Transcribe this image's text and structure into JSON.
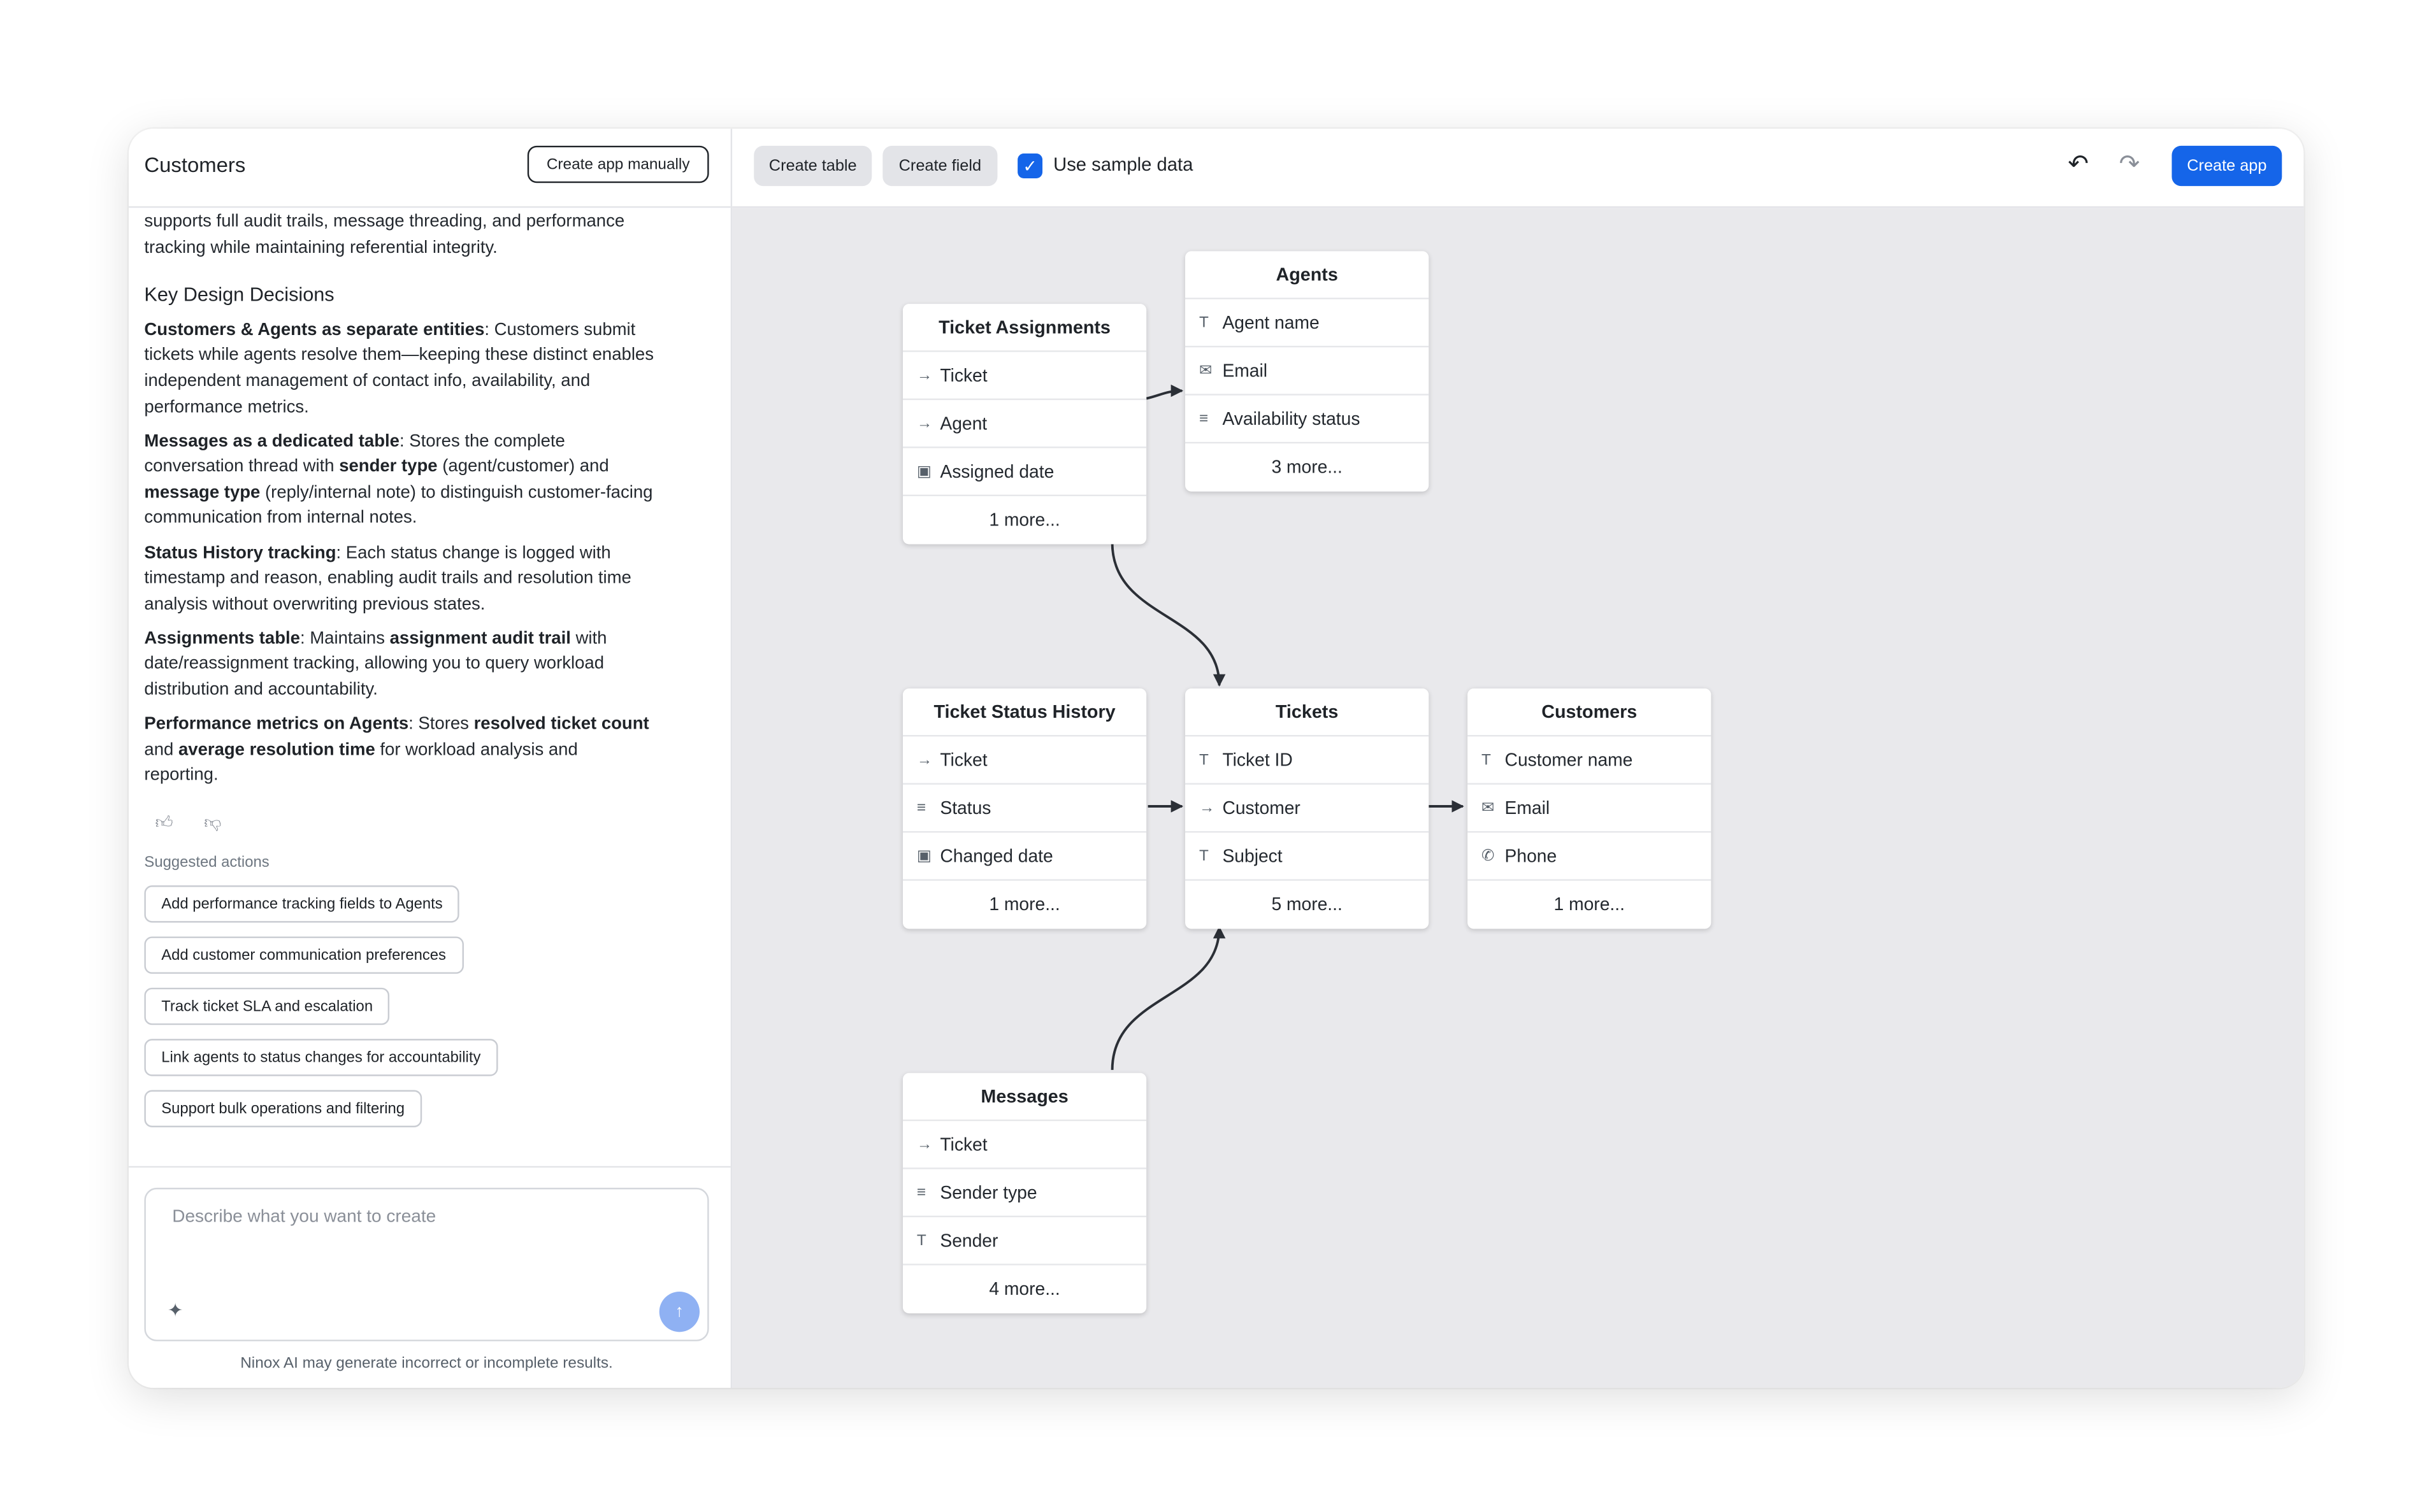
{
  "app": {
    "title": "Customers",
    "create_manually": "Create app manually"
  },
  "chat": {
    "intro": "supports full audit trails, message threading, and performance tracking while maintaining referential integrity.",
    "heading": "Key Design Decisions",
    "d1_b1": "Customers & Agents as separate entities",
    "d1_t1": ": Customers submit tickets while agents resolve them—keeping these distinct enables independent management of contact info, availability, and performance metrics.",
    "d2_b1": "Messages as a dedicated table",
    "d2_t1": ": Stores the complete conversation thread with ",
    "d2_b2": "sender type",
    "d2_t2": " (agent/customer) and ",
    "d2_b3": "message type",
    "d2_t3": " (reply/internal note) to distinguish customer-facing communication from internal notes.",
    "d3_b1": "Status History tracking",
    "d3_t1": ": Each status change is logged with timestamp and reason, enabling audit trails and resolution time analysis without overwriting previous states.",
    "d4_b1": "Assignments table",
    "d4_t1": ": Maintains ",
    "d4_b2": "assignment audit trail",
    "d4_t2": " with date/reassignment tracking, allowing you to query workload distribution and accountability.",
    "d5_b1": "Performance metrics on Agents",
    "d5_t1": ": Stores ",
    "d5_b2": "resolved ticket count",
    "d5_t2": " and ",
    "d5_b3": "average resolution time",
    "d5_t3": " for workload analysis and reporting."
  },
  "suggestions": {
    "title": "Suggested actions",
    "items": [
      "Add performance tracking fields to Agents",
      "Add customer communication preferences",
      "Track ticket SLA and escalation",
      "Link agents to status changes for accountability",
      "Support bulk operations and filtering"
    ]
  },
  "composer": {
    "placeholder": "Describe what you want to create",
    "disclaimer": "Ninox AI may generate incorrect or incomplete results."
  },
  "toolbar": {
    "create_table": "Create table",
    "create_field": "Create field",
    "use_sample_data": "Use sample data",
    "use_sample_data_checked": true,
    "create_app": "Create app",
    "accent": "#1565e9"
  },
  "tables": {
    "ticket_assignments": {
      "name": "Ticket Assignments",
      "fields": [
        {
          "icon": "link-icon",
          "label": "Ticket"
        },
        {
          "icon": "link-icon",
          "label": "Agent"
        },
        {
          "icon": "calendar-icon",
          "label": "Assigned date"
        }
      ],
      "more": "1 more..."
    },
    "agents": {
      "name": "Agents",
      "fields": [
        {
          "icon": "text-icon",
          "label": "Agent name"
        },
        {
          "icon": "mail-icon",
          "label": "Email"
        },
        {
          "icon": "list-icon",
          "label": "Availability status"
        }
      ],
      "more": "3 more..."
    },
    "ticket_status_history": {
      "name": "Ticket Status History",
      "fields": [
        {
          "icon": "link-icon",
          "label": "Ticket"
        },
        {
          "icon": "list-icon",
          "label": "Status"
        },
        {
          "icon": "calendar-icon",
          "label": "Changed date"
        }
      ],
      "more": "1 more..."
    },
    "tickets": {
      "name": "Tickets",
      "fields": [
        {
          "icon": "text-icon",
          "label": "Ticket ID"
        },
        {
          "icon": "link-icon",
          "label": "Customer"
        },
        {
          "icon": "text-icon",
          "label": "Subject"
        }
      ],
      "more": "5 more..."
    },
    "customers": {
      "name": "Customers",
      "fields": [
        {
          "icon": "text-icon",
          "label": "Customer name"
        },
        {
          "icon": "mail-icon",
          "label": "Email"
        },
        {
          "icon": "phone-icon",
          "label": "Phone"
        }
      ],
      "more": "1 more..."
    },
    "messages": {
      "name": "Messages",
      "fields": [
        {
          "icon": "link-icon",
          "label": "Ticket"
        },
        {
          "icon": "list-icon",
          "label": "Sender type"
        },
        {
          "icon": "text-icon",
          "label": "Sender"
        }
      ],
      "more": "4 more..."
    }
  }
}
